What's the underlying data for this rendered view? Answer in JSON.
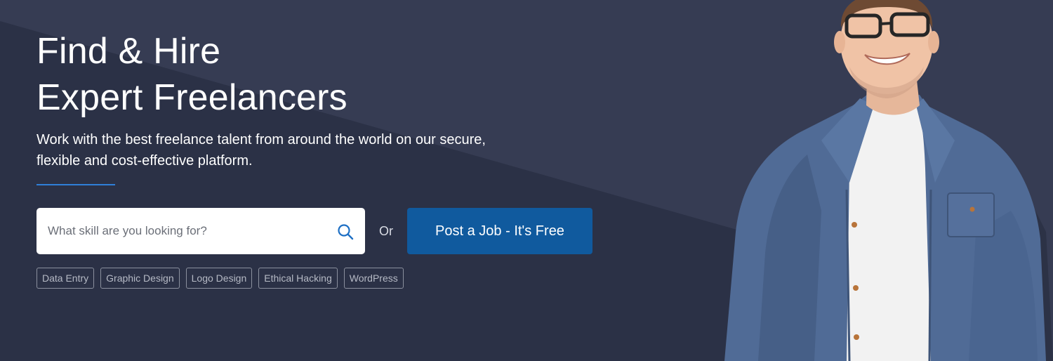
{
  "hero": {
    "headline_line1": "Find & Hire",
    "headline_line2": "Expert Freelancers",
    "subtitle": "Work with the best freelance talent from around the world on our secure, flexible and cost-effective platform."
  },
  "search": {
    "placeholder": "What skill are you looking for?",
    "value": "",
    "icon": "search-icon"
  },
  "or_label": "Or",
  "post_job": {
    "label": "Post a Job - It's Free"
  },
  "tags": [
    "Data Entry",
    "Graphic Design",
    "Logo Design",
    "Ethical Hacking",
    "WordPress"
  ],
  "colors": {
    "background": "#2b3146",
    "background_light": "#363c53",
    "accent_rule": "#2f7fd8",
    "button": "#105a9e",
    "search_icon": "#1d6fc4",
    "tag_border": "#8b909e",
    "tag_text": "#b6bac5"
  }
}
